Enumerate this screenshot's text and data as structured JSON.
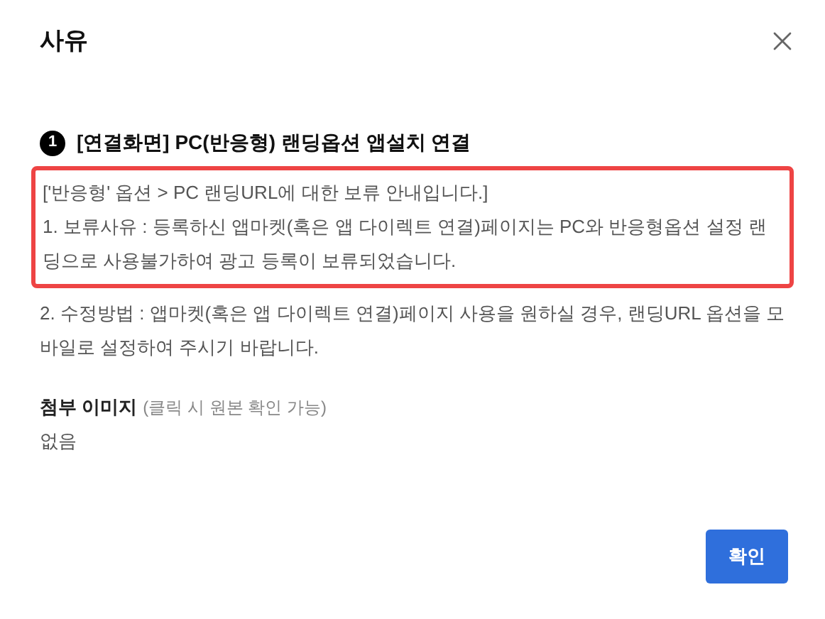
{
  "dialog": {
    "title": "사유"
  },
  "section": {
    "number": "1",
    "heading": "[연결화면] PC(반응형) 랜딩옵션 앱설치 연결",
    "highlighted_lines": [
      "['반응형' 옵션 > PC 랜딩URL에 대한 보류 안내입니다.]",
      "1. 보류사유 : 등록하신 앱마켓(혹은 앱 다이렉트 연결)페이지는 PC와 반응형옵션 설정 랜딩으로 사용불가하여 광고 등록이 보류되었습니다."
    ],
    "fix_text": "2. 수정방법 : 앱마켓(혹은 앱 다이렉트 연결)페이지 사용을 원하실 경우, 랜딩URL 옵션을 모바일로 설정하여 주시기 바랍니다."
  },
  "attachment": {
    "label": "첨부 이미지",
    "hint": "(클릭 시 원본 확인 가능)",
    "value": "없음"
  },
  "buttons": {
    "confirm": "확인"
  }
}
